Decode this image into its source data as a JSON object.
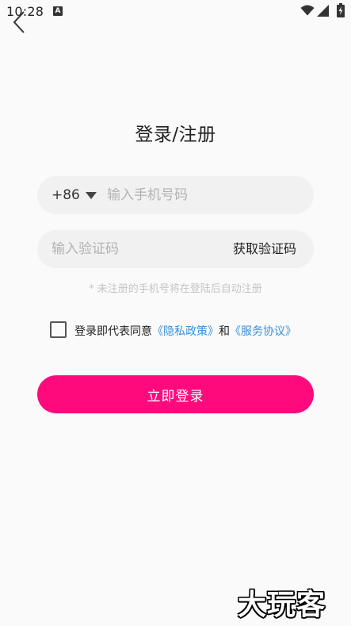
{
  "status_bar": {
    "time": "10:28",
    "notification_icon": "A"
  },
  "page": {
    "title": "登录/注册"
  },
  "phone_field": {
    "country_code": "+86",
    "placeholder": "输入手机号码",
    "value": ""
  },
  "code_field": {
    "placeholder": "输入验证码",
    "value": "",
    "get_code_label": "获取验证码"
  },
  "hint": "* 未注册的手机号将在登陆后自动注册",
  "agreement": {
    "checked": false,
    "prefix": "登录即代表同意",
    "privacy_link": "《隐私政策》",
    "joiner": "和",
    "service_link": "《服务协议》"
  },
  "login_button": {
    "label": "立即登录"
  },
  "watermark": "大玩客",
  "colors": {
    "accent": "#ff0a7d",
    "link": "#3a8fd9",
    "field_bg": "#f1f1f1",
    "background": "#fafafa"
  }
}
